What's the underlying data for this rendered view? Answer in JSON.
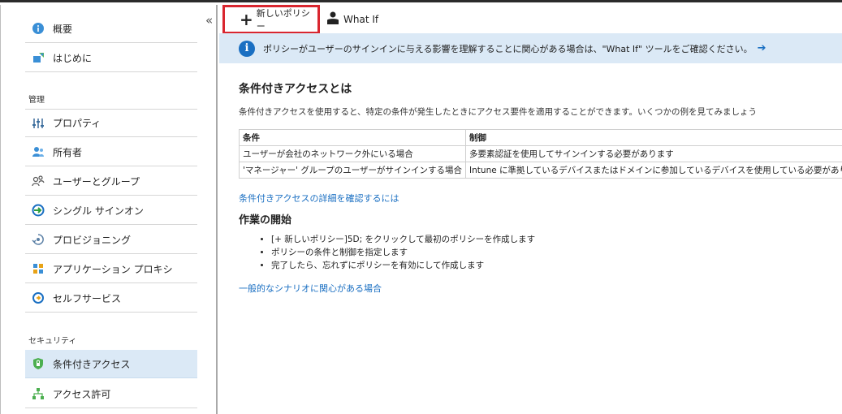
{
  "sidebar": {
    "collapse_glyph": "«",
    "items_top": [
      {
        "label": "概要",
        "icon": "info-icon"
      },
      {
        "label": "はじめに",
        "icon": "getting-started-icon"
      }
    ],
    "section_manage": "管理",
    "items_manage": [
      {
        "label": "プロパティ",
        "icon": "properties-icon"
      },
      {
        "label": "所有者",
        "icon": "owners-icon"
      },
      {
        "label": "ユーザーとグループ",
        "icon": "users-groups-icon"
      },
      {
        "label": "シングル サインオン",
        "icon": "single-sign-on-icon"
      },
      {
        "label": "プロビジョニング",
        "icon": "provisioning-icon"
      },
      {
        "label": "アプリケーション プロキシ",
        "icon": "app-proxy-icon"
      },
      {
        "label": "セルフサービス",
        "icon": "self-service-icon"
      }
    ],
    "section_security": "セキュリティ",
    "items_security": [
      {
        "label": "条件付きアクセス",
        "icon": "conditional-access-icon",
        "selected": true
      },
      {
        "label": "アクセス許可",
        "icon": "permissions-icon"
      }
    ]
  },
  "toolbar": {
    "new_policy_label": "新しいポリシー",
    "whatif_label": "What If"
  },
  "banner": {
    "message": "ポリシーがユーザーのサインインに与える影響を理解することに関心がある場合は、\"What If\" ツールをご確認ください。",
    "arrow": "➔"
  },
  "main": {
    "title": "条件付きアクセスとは",
    "description": "条件付きアクセスを使用すると、特定の条件が発生したときにアクセス要件を適用することができます。いくつかの例を見てみましょう",
    "table": {
      "headers": [
        "条件",
        "制御"
      ],
      "rows": [
        [
          "ユーザーが会社のネットワーク外にいる場合",
          "多要素認証を使用してサインインする必要があります"
        ],
        [
          "'マネージャー' グループのユーザーがサインインする場合",
          "Intune に準拠しているデバイスまたはドメインに参加しているデバイスを使用している必要があります"
        ]
      ]
    },
    "learn_more_link": "条件付きアクセスの詳細を確認するには",
    "getting_started_title": "作業の開始",
    "steps": [
      "[+ 新しいポリシー]5D; をクリックして最初のポリシーを作成します",
      "ポリシーの条件と制御を指定します",
      "完了したら、忘れずにポリシーを有効にして作成します"
    ],
    "scenarios_link": "一般的なシナリオに関心がある場合"
  },
  "colors": {
    "accent": "#1a6fc2",
    "highlight_border": "#d9262f",
    "banner_bg": "#dbe9f6",
    "selected_bg": "#dbe9f6"
  }
}
